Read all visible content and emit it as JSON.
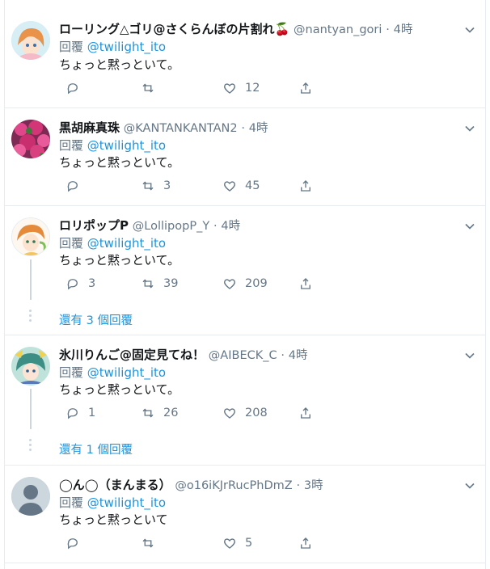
{
  "colors": {
    "link": "#1b95e0",
    "muted": "#657786",
    "border": "#e6ecf0"
  },
  "tweets": [
    {
      "name": "ローリング△ゴリ@さくらんぼの片割れ🍒",
      "handle": "@nantyan_gori",
      "sep": "·",
      "time": "4時",
      "reply_label": "回覆",
      "reply_to": "@twilight_ito",
      "text": "ちょっと黙っといて。",
      "reply_count": "",
      "retweet_count": "",
      "like_count": "12",
      "avatar_icon": "anime-girl-avatar"
    },
    {
      "name": "黒胡麻真珠",
      "handle": "@KANTANKANTAN2",
      "sep": "·",
      "time": "4時",
      "reply_label": "回覆",
      "reply_to": "@twilight_ito",
      "text": "ちょっと黙っといて。",
      "reply_count": "",
      "retweet_count": "3",
      "like_count": "45",
      "avatar_icon": "pink-flowers-avatar"
    },
    {
      "name": "ロリポップP",
      "handle": "@LollipopP_Y",
      "sep": "·",
      "time": "4時",
      "reply_label": "回覆",
      "reply_to": "@twilight_ito",
      "text": "ちょっと黙っといて。",
      "reply_count": "3",
      "retweet_count": "39",
      "like_count": "209",
      "avatar_icon": "anime-boy-avatar",
      "more_replies": "還有 3 個回覆"
    },
    {
      "name": "氷川りんご@固定見てね！",
      "handle": "@AIBECK_C",
      "sep": "·",
      "time": "4時",
      "reply_label": "回覆",
      "reply_to": "@twilight_ito",
      "text": "ちょっと黙っといて。",
      "reply_count": "1",
      "retweet_count": "26",
      "like_count": "208",
      "avatar_icon": "anime-character-avatar",
      "more_replies": "還有 1 個回覆"
    },
    {
      "name": "◯ん◯（まんまる）",
      "handle": "@o16iKJrRucPhDmZ",
      "sep": "·",
      "time": "3時",
      "reply_label": "回覆",
      "reply_to": "@twilight_ito",
      "text": "ちょっと黙っといて",
      "reply_count": "",
      "retweet_count": "",
      "like_count": "5",
      "avatar_icon": "default-profile-avatar"
    }
  ]
}
